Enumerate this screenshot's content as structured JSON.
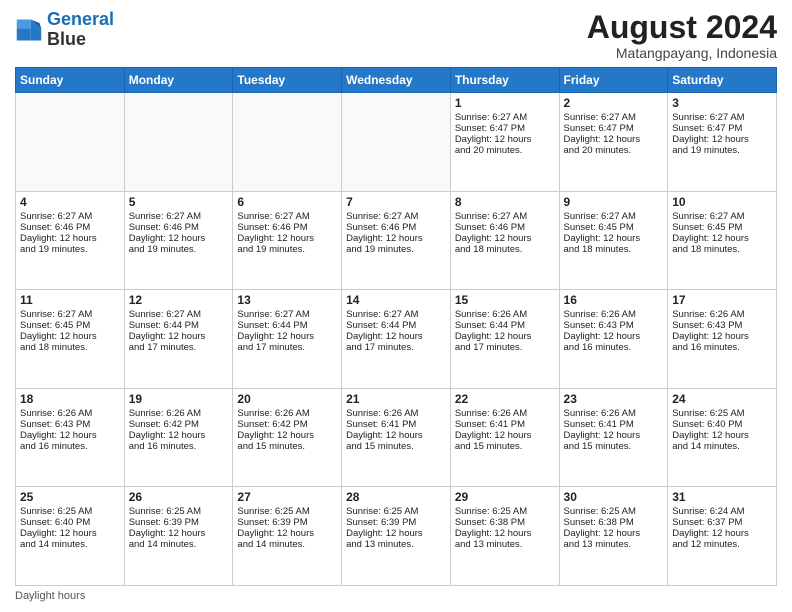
{
  "logo": {
    "line1": "General",
    "line2": "Blue"
  },
  "title": "August 2024",
  "location": "Matangpayang, Indonesia",
  "days_of_week": [
    "Sunday",
    "Monday",
    "Tuesday",
    "Wednesday",
    "Thursday",
    "Friday",
    "Saturday"
  ],
  "footer": "Daylight hours",
  "weeks": [
    [
      {
        "day": "",
        "info": ""
      },
      {
        "day": "",
        "info": ""
      },
      {
        "day": "",
        "info": ""
      },
      {
        "day": "",
        "info": ""
      },
      {
        "day": "1",
        "info": "Sunrise: 6:27 AM\nSunset: 6:47 PM\nDaylight: 12 hours\nand 20 minutes."
      },
      {
        "day": "2",
        "info": "Sunrise: 6:27 AM\nSunset: 6:47 PM\nDaylight: 12 hours\nand 20 minutes."
      },
      {
        "day": "3",
        "info": "Sunrise: 6:27 AM\nSunset: 6:47 PM\nDaylight: 12 hours\nand 19 minutes."
      }
    ],
    [
      {
        "day": "4",
        "info": "Sunrise: 6:27 AM\nSunset: 6:46 PM\nDaylight: 12 hours\nand 19 minutes."
      },
      {
        "day": "5",
        "info": "Sunrise: 6:27 AM\nSunset: 6:46 PM\nDaylight: 12 hours\nand 19 minutes."
      },
      {
        "day": "6",
        "info": "Sunrise: 6:27 AM\nSunset: 6:46 PM\nDaylight: 12 hours\nand 19 minutes."
      },
      {
        "day": "7",
        "info": "Sunrise: 6:27 AM\nSunset: 6:46 PM\nDaylight: 12 hours\nand 19 minutes."
      },
      {
        "day": "8",
        "info": "Sunrise: 6:27 AM\nSunset: 6:46 PM\nDaylight: 12 hours\nand 18 minutes."
      },
      {
        "day": "9",
        "info": "Sunrise: 6:27 AM\nSunset: 6:45 PM\nDaylight: 12 hours\nand 18 minutes."
      },
      {
        "day": "10",
        "info": "Sunrise: 6:27 AM\nSunset: 6:45 PM\nDaylight: 12 hours\nand 18 minutes."
      }
    ],
    [
      {
        "day": "11",
        "info": "Sunrise: 6:27 AM\nSunset: 6:45 PM\nDaylight: 12 hours\nand 18 minutes."
      },
      {
        "day": "12",
        "info": "Sunrise: 6:27 AM\nSunset: 6:44 PM\nDaylight: 12 hours\nand 17 minutes."
      },
      {
        "day": "13",
        "info": "Sunrise: 6:27 AM\nSunset: 6:44 PM\nDaylight: 12 hours\nand 17 minutes."
      },
      {
        "day": "14",
        "info": "Sunrise: 6:27 AM\nSunset: 6:44 PM\nDaylight: 12 hours\nand 17 minutes."
      },
      {
        "day": "15",
        "info": "Sunrise: 6:26 AM\nSunset: 6:44 PM\nDaylight: 12 hours\nand 17 minutes."
      },
      {
        "day": "16",
        "info": "Sunrise: 6:26 AM\nSunset: 6:43 PM\nDaylight: 12 hours\nand 16 minutes."
      },
      {
        "day": "17",
        "info": "Sunrise: 6:26 AM\nSunset: 6:43 PM\nDaylight: 12 hours\nand 16 minutes."
      }
    ],
    [
      {
        "day": "18",
        "info": "Sunrise: 6:26 AM\nSunset: 6:43 PM\nDaylight: 12 hours\nand 16 minutes."
      },
      {
        "day": "19",
        "info": "Sunrise: 6:26 AM\nSunset: 6:42 PM\nDaylight: 12 hours\nand 16 minutes."
      },
      {
        "day": "20",
        "info": "Sunrise: 6:26 AM\nSunset: 6:42 PM\nDaylight: 12 hours\nand 15 minutes."
      },
      {
        "day": "21",
        "info": "Sunrise: 6:26 AM\nSunset: 6:41 PM\nDaylight: 12 hours\nand 15 minutes."
      },
      {
        "day": "22",
        "info": "Sunrise: 6:26 AM\nSunset: 6:41 PM\nDaylight: 12 hours\nand 15 minutes."
      },
      {
        "day": "23",
        "info": "Sunrise: 6:26 AM\nSunset: 6:41 PM\nDaylight: 12 hours\nand 15 minutes."
      },
      {
        "day": "24",
        "info": "Sunrise: 6:25 AM\nSunset: 6:40 PM\nDaylight: 12 hours\nand 14 minutes."
      }
    ],
    [
      {
        "day": "25",
        "info": "Sunrise: 6:25 AM\nSunset: 6:40 PM\nDaylight: 12 hours\nand 14 minutes."
      },
      {
        "day": "26",
        "info": "Sunrise: 6:25 AM\nSunset: 6:39 PM\nDaylight: 12 hours\nand 14 minutes."
      },
      {
        "day": "27",
        "info": "Sunrise: 6:25 AM\nSunset: 6:39 PM\nDaylight: 12 hours\nand 14 minutes."
      },
      {
        "day": "28",
        "info": "Sunrise: 6:25 AM\nSunset: 6:39 PM\nDaylight: 12 hours\nand 13 minutes."
      },
      {
        "day": "29",
        "info": "Sunrise: 6:25 AM\nSunset: 6:38 PM\nDaylight: 12 hours\nand 13 minutes."
      },
      {
        "day": "30",
        "info": "Sunrise: 6:25 AM\nSunset: 6:38 PM\nDaylight: 12 hours\nand 13 minutes."
      },
      {
        "day": "31",
        "info": "Sunrise: 6:24 AM\nSunset: 6:37 PM\nDaylight: 12 hours\nand 12 minutes."
      }
    ]
  ]
}
